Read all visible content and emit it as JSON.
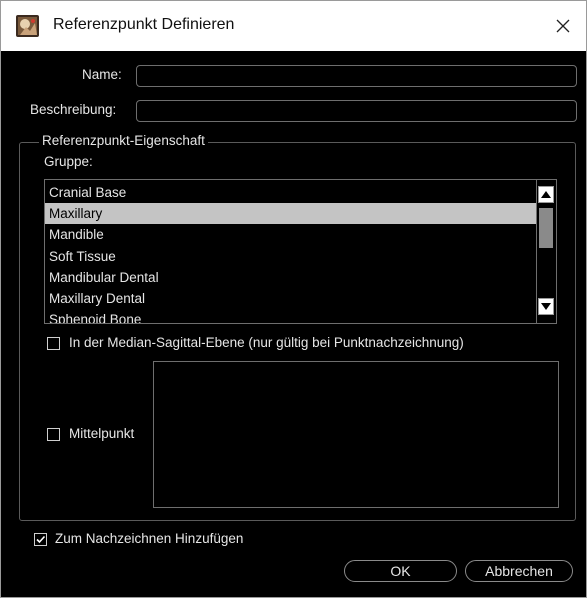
{
  "window": {
    "title": "Referenzpunkt Definieren",
    "icon": "app-icon",
    "close_glyph": "✕"
  },
  "form": {
    "name_label": "Name:",
    "name_value": "",
    "description_label": "Beschreibung:",
    "description_value": ""
  },
  "properties": {
    "group_title": "Referenzpunkt-Eigenschaft",
    "gruppe_label": "Gruppe:",
    "selected_index": 1,
    "items": [
      "Cranial Base",
      "Maxillary",
      "Mandible",
      "Soft Tissue",
      "Mandibular Dental",
      "Maxillary Dental",
      "Sphenoid Bone"
    ],
    "median_checkbox_label": "In der Median-Sagittal-Ebene (nur gültig bei Punktnachzeichnung)",
    "median_checked": false,
    "mittelpunkt_label": "Mittelpunkt",
    "mittelpunkt_checked": false
  },
  "footer": {
    "trace_checkbox_label": "Zum Nachzeichnen Hinzufügen",
    "trace_checked": true,
    "ok_label": "OK",
    "cancel_label": "Abbrechen"
  },
  "colors": {
    "background": "#000000",
    "text": "#e6e6e6",
    "selection": "#c4c4c4"
  }
}
